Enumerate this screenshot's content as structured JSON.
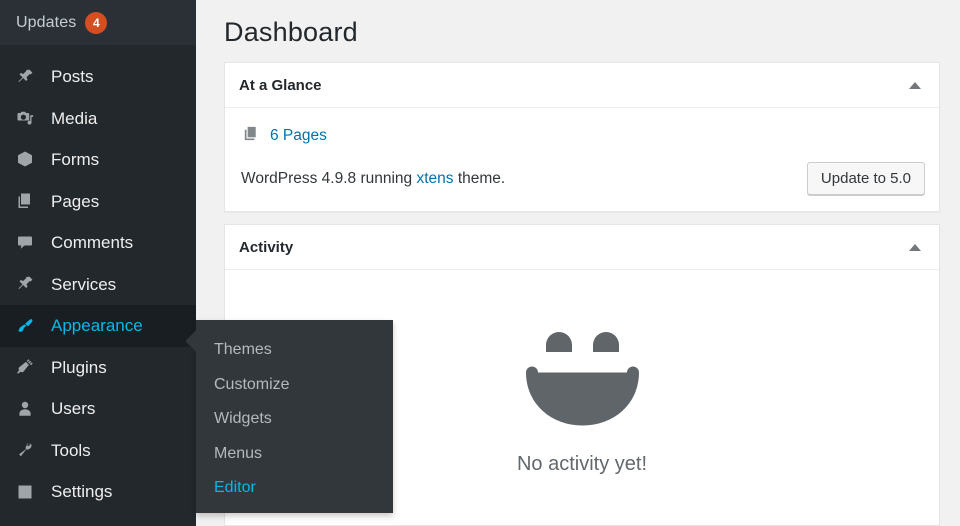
{
  "sidebar": {
    "updates": {
      "label": "Updates",
      "count": "4",
      "badge_color": "#d54e21"
    },
    "items": [
      {
        "label": "Posts",
        "icon": "pushpin-icon",
        "current": false
      },
      {
        "label": "Media",
        "icon": "media-icon",
        "current": false
      },
      {
        "label": "Forms",
        "icon": "forms-icon",
        "current": false
      },
      {
        "label": "Pages",
        "icon": "pages-icon",
        "current": false
      },
      {
        "label": "Comments",
        "icon": "comments-icon",
        "current": false
      },
      {
        "label": "Services",
        "icon": "pushpin-icon",
        "current": false
      },
      {
        "label": "Appearance",
        "icon": "paintbrush-icon",
        "current": true
      },
      {
        "label": "Plugins",
        "icon": "plugin-icon",
        "current": false
      },
      {
        "label": "Users",
        "icon": "user-icon",
        "current": false
      },
      {
        "label": "Tools",
        "icon": "wrench-icon",
        "current": false
      },
      {
        "label": "Settings",
        "icon": "sliders-icon",
        "current": false
      }
    ],
    "active_color": "#00b9eb",
    "background": "#23282d"
  },
  "flyout": {
    "parent": "Appearance",
    "items": [
      {
        "label": "Themes",
        "current": false
      },
      {
        "label": "Customize",
        "current": false
      },
      {
        "label": "Widgets",
        "current": false
      },
      {
        "label": "Menus",
        "current": false
      },
      {
        "label": "Editor",
        "current": true
      }
    ]
  },
  "main": {
    "page_title": "Dashboard",
    "glance": {
      "title": "At a Glance",
      "pages_link": "6 Pages",
      "version_prefix": "WordPress 4.9.8 running ",
      "theme_link": "xtens",
      "version_suffix": " theme.",
      "update_button": "Update to 5.0"
    },
    "activity": {
      "title": "Activity",
      "empty_message": "No activity yet!"
    }
  }
}
